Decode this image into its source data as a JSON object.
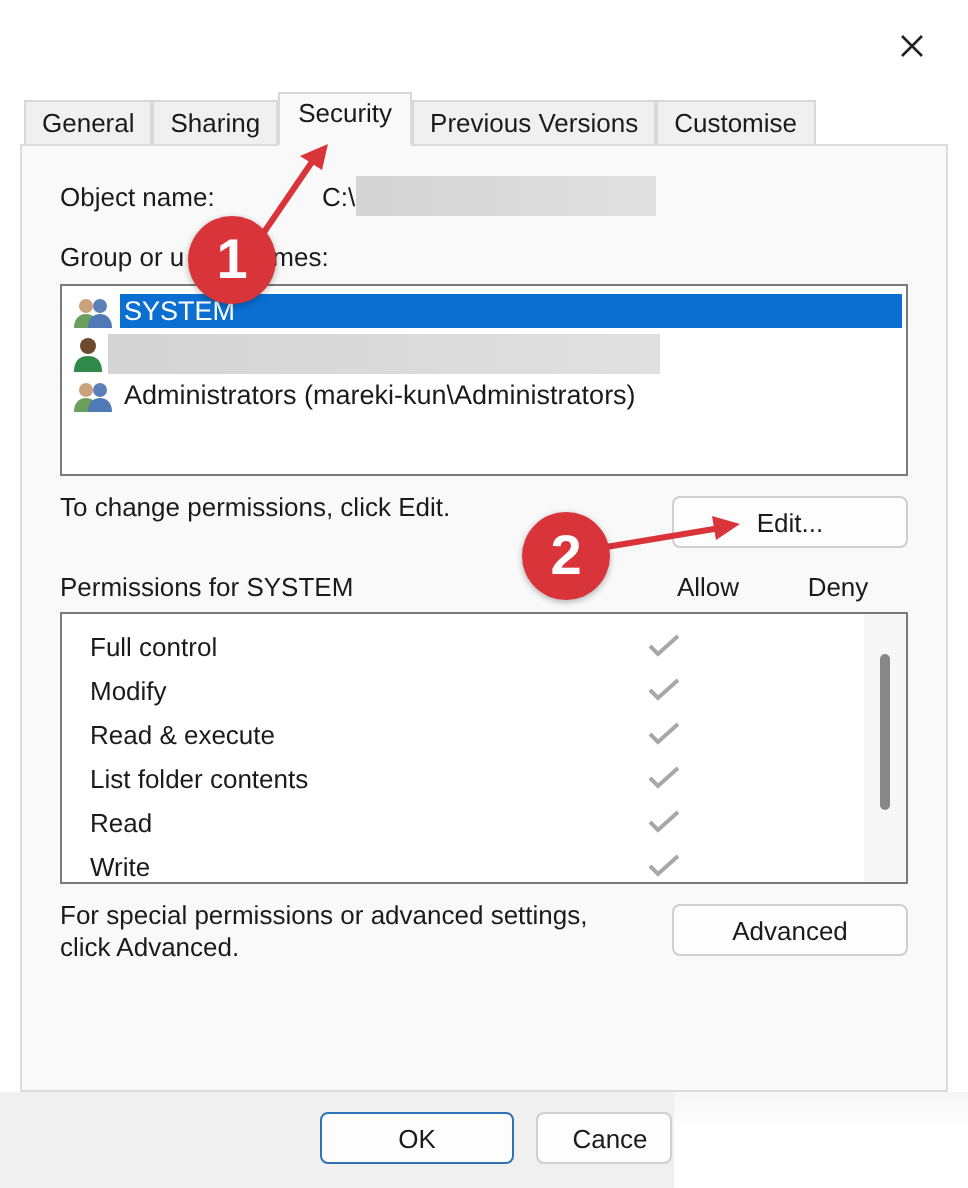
{
  "tabs": [
    {
      "label": "General",
      "selected": false
    },
    {
      "label": "Sharing",
      "selected": false
    },
    {
      "label": "Security",
      "selected": true
    },
    {
      "label": "Previous Versions",
      "selected": false
    },
    {
      "label": "Customise",
      "selected": false
    }
  ],
  "object_name": {
    "label": "Object name:",
    "value": "C:\\"
  },
  "group_label": [
    "Group or u",
    "mes:"
  ],
  "users": [
    {
      "kind": "group",
      "name": "SYSTEM",
      "selected": true
    },
    {
      "kind": "redacted",
      "selected": false
    },
    {
      "kind": "group",
      "name": "Administrators (mareki-kun\\Administrators)",
      "selected": false
    }
  ],
  "change_hint": "To change permissions, click Edit.",
  "edit_button": "Edit...",
  "permissions": {
    "title": "Permissions for SYSTEM",
    "columns": [
      "Allow",
      "Deny"
    ],
    "rows": [
      {
        "name": "Full control",
        "allow": true
      },
      {
        "name": "Modify",
        "allow": true
      },
      {
        "name": "Read & execute",
        "allow": true
      },
      {
        "name": "List folder contents",
        "allow": true
      },
      {
        "name": "Read",
        "allow": true
      },
      {
        "name": "Write",
        "allow": true
      }
    ]
  },
  "advanced_hint": "For special permissions or advanced settings, click Advanced.",
  "advanced_button": "Advanced",
  "buttons": [
    {
      "label": "OK",
      "kind": "default"
    },
    {
      "label": "Cance",
      "kind": "normal"
    }
  ],
  "callouts": [
    "1",
    "2"
  ]
}
